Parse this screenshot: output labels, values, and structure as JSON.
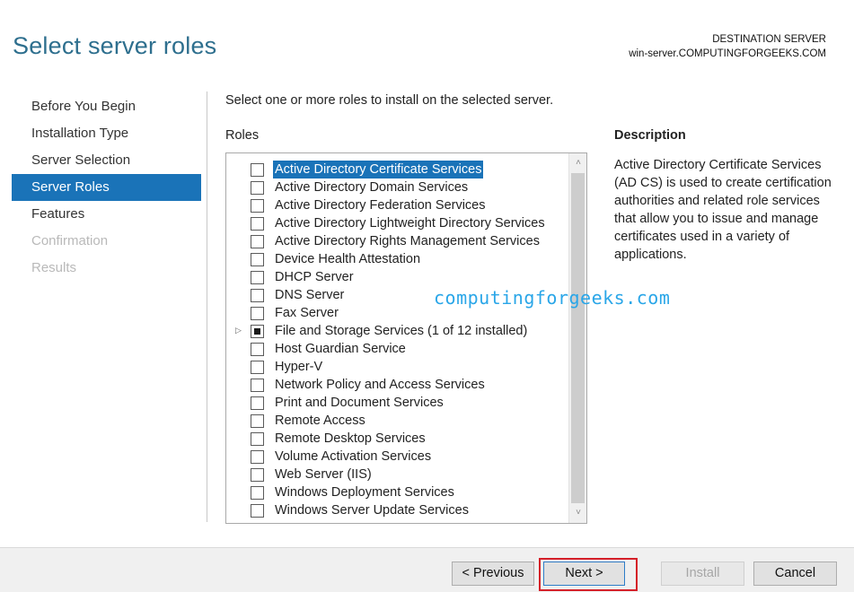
{
  "header": {
    "title": "Select server roles",
    "destination_label": "DESTINATION SERVER",
    "destination_server": "win-server.COMPUTINGFORGEEKS.COM"
  },
  "nav": {
    "items": [
      {
        "label": "Before You Begin",
        "state": "normal"
      },
      {
        "label": "Installation Type",
        "state": "normal"
      },
      {
        "label": "Server Selection",
        "state": "normal"
      },
      {
        "label": "Server Roles",
        "state": "active"
      },
      {
        "label": "Features",
        "state": "normal"
      },
      {
        "label": "Confirmation",
        "state": "disabled"
      },
      {
        "label": "Results",
        "state": "disabled"
      }
    ]
  },
  "main": {
    "instruction": "Select one or more roles to install on the selected server.",
    "roles_label": "Roles",
    "roles": [
      {
        "label": "Active Directory Certificate Services",
        "checked": false,
        "selected": true
      },
      {
        "label": "Active Directory Domain Services",
        "checked": false
      },
      {
        "label": "Active Directory Federation Services",
        "checked": false
      },
      {
        "label": "Active Directory Lightweight Directory Services",
        "checked": false
      },
      {
        "label": "Active Directory Rights Management Services",
        "checked": false
      },
      {
        "label": "Device Health Attestation",
        "checked": false
      },
      {
        "label": "DHCP Server",
        "checked": false
      },
      {
        "label": "DNS Server",
        "checked": false
      },
      {
        "label": "Fax Server",
        "checked": false
      },
      {
        "label": "File and Storage Services (1 of 12 installed)",
        "checked": "partial",
        "expandable": true
      },
      {
        "label": "Host Guardian Service",
        "checked": false
      },
      {
        "label": "Hyper-V",
        "checked": false
      },
      {
        "label": "Network Policy and Access Services",
        "checked": false
      },
      {
        "label": "Print and Document Services",
        "checked": false
      },
      {
        "label": "Remote Access",
        "checked": false
      },
      {
        "label": "Remote Desktop Services",
        "checked": false
      },
      {
        "label": "Volume Activation Services",
        "checked": false
      },
      {
        "label": "Web Server (IIS)",
        "checked": false
      },
      {
        "label": "Windows Deployment Services",
        "checked": false
      },
      {
        "label": "Windows Server Update Services",
        "checked": false
      }
    ],
    "description_title": "Description",
    "description_text": "Active Directory Certificate Services (AD CS) is used to create certification authorities and related role services that allow you to issue and manage certificates used in a variety of applications."
  },
  "watermark": "computingforgeeks.com",
  "footer": {
    "previous_label": "< Previous",
    "next_label": "Next >",
    "install_label": "Install",
    "cancel_label": "Cancel"
  },
  "colors": {
    "accent": "#1a73b8",
    "title": "#2e6f8e",
    "watermark": "#2aa6e8",
    "highlight_border": "#d51f28"
  },
  "icons": {
    "scroll_up": "chevron-up-icon",
    "scroll_down": "chevron-down-icon",
    "expander": "triangle-right-icon"
  }
}
